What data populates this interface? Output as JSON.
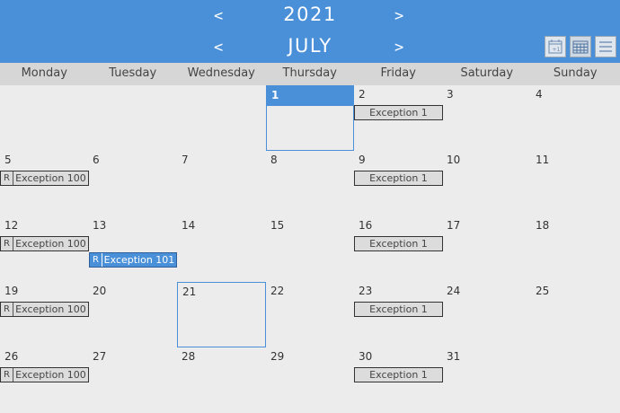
{
  "header": {
    "year": "2021",
    "month": "JULY",
    "prev_label": "<",
    "next_label": ">",
    "accent_color": "#4a90d9",
    "view_buttons": [
      "calendar-day-icon",
      "calendar-month-icon",
      "list-view-icon"
    ]
  },
  "weekdays": [
    "Monday",
    "Tuesday",
    "Wednesday",
    "Thursday",
    "Friday",
    "Saturday",
    "Sunday"
  ],
  "weeks": [
    [
      "",
      "",
      "",
      "1",
      "2",
      "3",
      "4"
    ],
    [
      "5",
      "6",
      "7",
      "8",
      "9",
      "10",
      "11"
    ],
    [
      "12",
      "13",
      "14",
      "15",
      "16",
      "17",
      "18"
    ],
    [
      "19",
      "20",
      "21",
      "22",
      "23",
      "24",
      "25"
    ],
    [
      "26",
      "27",
      "28",
      "29",
      "30",
      "31",
      ""
    ]
  ],
  "today_day": "1",
  "selected_day": "21",
  "events": {
    "week0": {
      "fri": "Exception 1"
    },
    "week1": {
      "mon": "Exception 100",
      "mon_tag": "R",
      "fri": "Exception 1"
    },
    "week2": {
      "mon": "Exception 100",
      "mon_tag": "R",
      "tue": "Exception 101",
      "tue_tag": "R",
      "fri": "Exception 1"
    },
    "week3": {
      "mon": "Exception 100",
      "mon_tag": "R",
      "fri": "Exception 1"
    },
    "week4": {
      "mon": "Exception 100",
      "mon_tag": "R",
      "fri": "Exception 1"
    }
  }
}
